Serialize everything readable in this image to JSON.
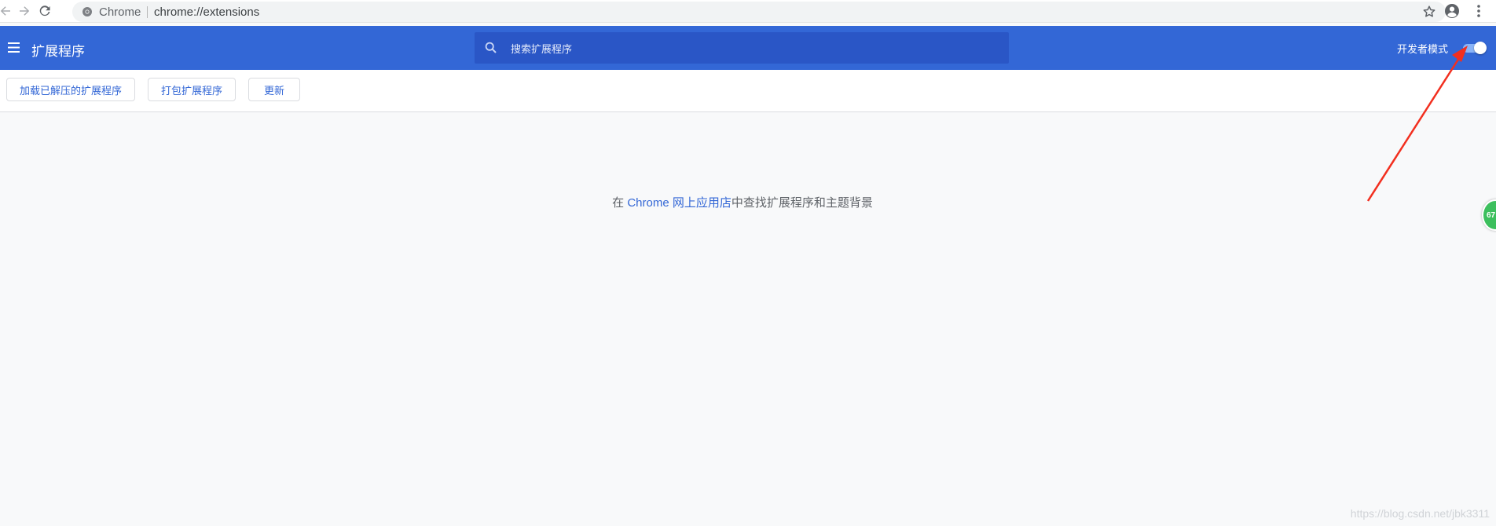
{
  "browser": {
    "site_label": "Chrome",
    "url": "chrome://extensions"
  },
  "header": {
    "title": "扩展程序",
    "search_placeholder": "搜索扩展程序",
    "devmode_label": "开发者模式",
    "devmode_on": true
  },
  "actions": {
    "load_unpacked": "加载已解压的扩展程序",
    "pack": "打包扩展程序",
    "update": "更新"
  },
  "main": {
    "prefix": "在 ",
    "store_link": "Chrome 网上应用店",
    "suffix": "中查找扩展程序和主题背景"
  },
  "floating_badge": "67",
  "watermark": "https://blog.csdn.net/jbk3311",
  "colors": {
    "header_bg": "#3367d6",
    "search_bg": "#2a56c6",
    "link": "#3367d6",
    "annotation_arrow": "#f22f1f"
  }
}
